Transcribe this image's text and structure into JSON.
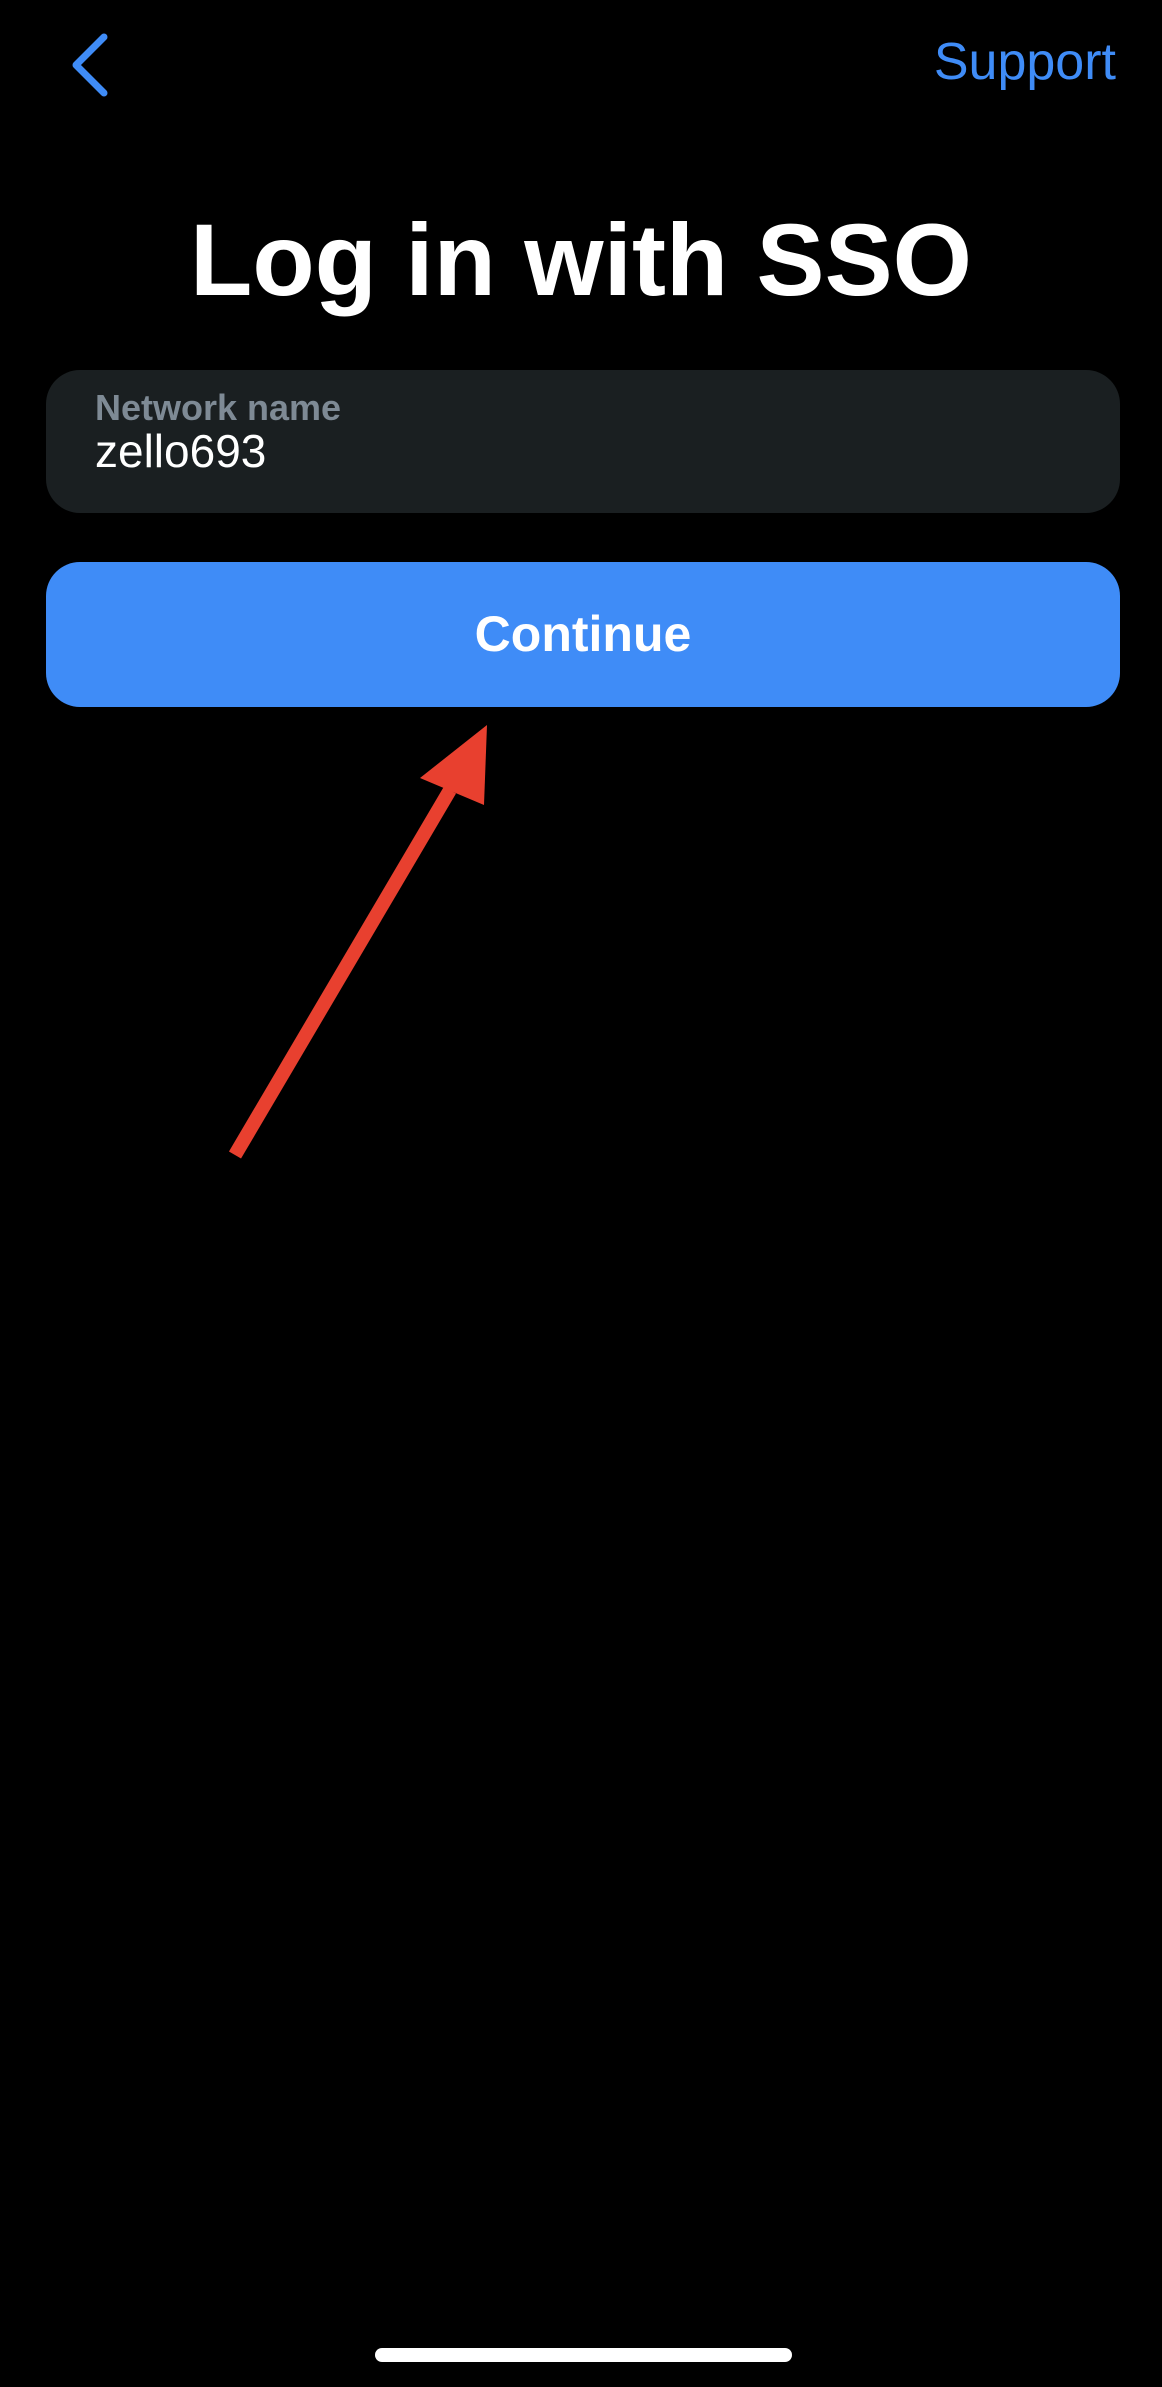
{
  "nav": {
    "back_icon": "chevron-left-icon",
    "support_label": "Support"
  },
  "title": "Log in with SSO",
  "network_field": {
    "label": "Network name",
    "value": "zello693"
  },
  "continue_label": "Continue",
  "annotation": {
    "icon": "arrow-up-right-icon",
    "color": "#e8402f"
  },
  "colors": {
    "background": "#000000",
    "accent": "#3f8cf7",
    "field_background": "#1a1f21",
    "field_label": "#7e8a95",
    "text": "#ffffff"
  }
}
